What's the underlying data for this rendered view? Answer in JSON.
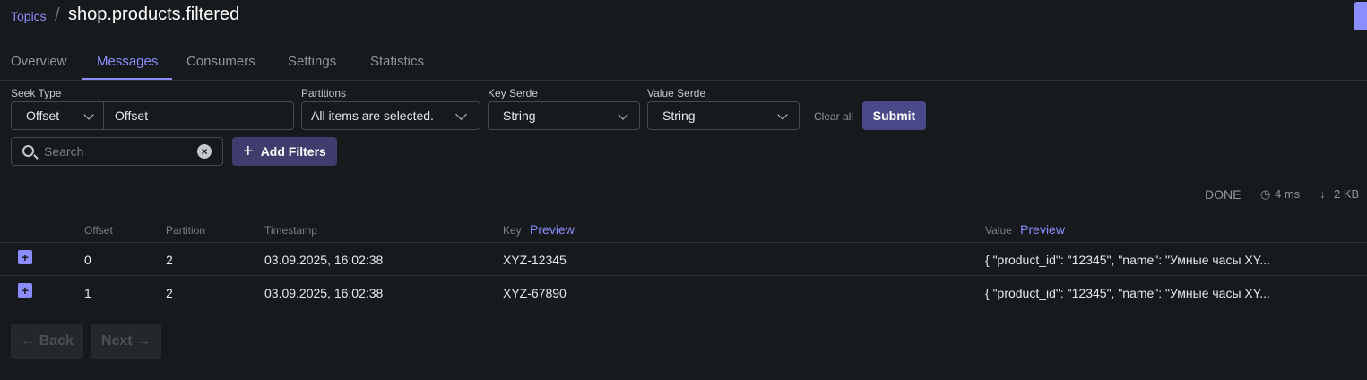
{
  "breadcrumb": {
    "link": "Topics",
    "separator": "/",
    "title": "shop.products.filtered"
  },
  "tabs": [
    {
      "label": "Overview",
      "active": false
    },
    {
      "label": "Messages",
      "active": true
    },
    {
      "label": "Consumers",
      "active": false
    },
    {
      "label": "Settings",
      "active": false
    },
    {
      "label": "Statistics",
      "active": false
    }
  ],
  "filters": {
    "seek_type": {
      "label": "Seek Type",
      "value": "Offset",
      "input_placeholder": "Offset"
    },
    "partitions": {
      "label": "Partitions",
      "value": "All items are selected."
    },
    "key_serde": {
      "label": "Key Serde",
      "value": "String"
    },
    "value_serde": {
      "label": "Value Serde",
      "value": "String"
    },
    "clear_all": "Clear all",
    "submit": "Submit"
  },
  "search": {
    "placeholder": "Search",
    "icon": "search-icon",
    "clear_icon": "×"
  },
  "add_filters": {
    "label": "Add Filters",
    "icon": "+"
  },
  "meta": {
    "status": "DONE",
    "elapsed": "4 ms",
    "size": "2 KB",
    "elapsed_icon": "◷",
    "size_icon": "↓"
  },
  "table": {
    "headers": {
      "offset": "Offset",
      "partition": "Partition",
      "timestamp": "Timestamp",
      "key": "Key",
      "key_preview": "Preview",
      "value": "Value",
      "value_preview": "Preview"
    },
    "rows": [
      {
        "expand": "+",
        "offset": "0",
        "partition": "2",
        "timestamp": "03.09.2025, 16:02:38",
        "key": "XYZ-12345",
        "value": "{ \"product_id\": \"12345\", \"name\": \"Умные часы XY..."
      },
      {
        "expand": "+",
        "offset": "1",
        "partition": "2",
        "timestamp": "03.09.2025, 16:02:38",
        "key": "XYZ-67890",
        "value": "{ \"product_id\": \"12345\", \"name\": \"Умные часы XY..."
      }
    ]
  },
  "pagination": {
    "back": "← Back",
    "next": "Next →"
  },
  "colors": {
    "background": "#171a1c",
    "accent": "#8b8dff",
    "submit_bg": "#4a4a8a",
    "add_filters_bg": "#3e3d6e"
  }
}
